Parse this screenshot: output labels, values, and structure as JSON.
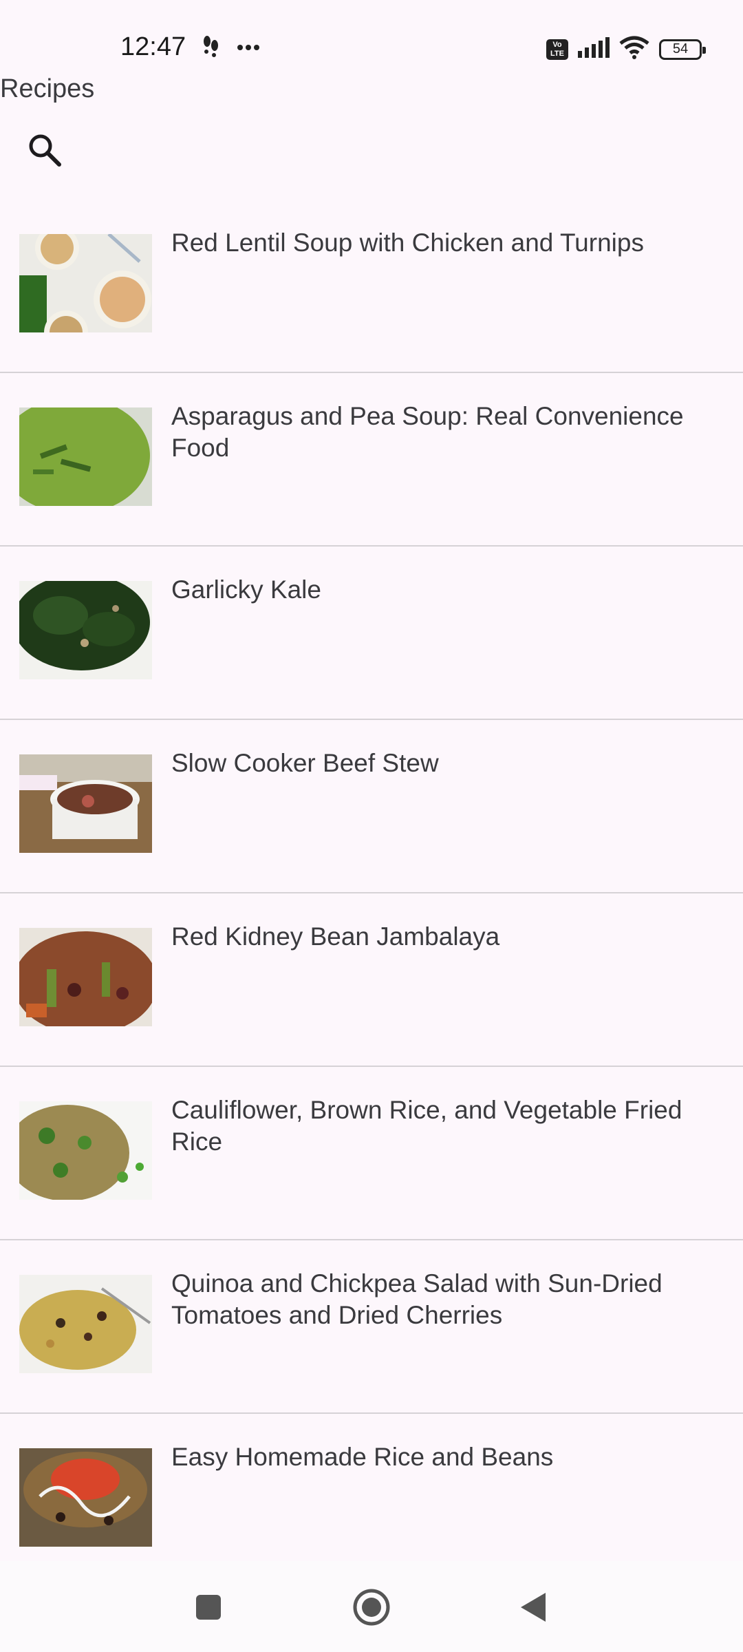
{
  "status_bar": {
    "time": "12:47",
    "battery_level": "54",
    "volte_label": "Vo LTE",
    "icons": [
      "footprints-icon",
      "more-dots-icon",
      "volte-icon",
      "signal-icon",
      "wifi-icon",
      "battery-icon"
    ]
  },
  "app_bar": {
    "title": "Recipes",
    "search_icon": "search-icon"
  },
  "recipes": [
    {
      "title": "Red Lentil Soup with Chicken and Turnips",
      "thumb": "soup-bowls-image"
    },
    {
      "title": "Asparagus and Pea Soup: Real Convenience Food",
      "thumb": "green-soup-image"
    },
    {
      "title": "Garlicky Kale",
      "thumb": "kale-image"
    },
    {
      "title": "Slow Cooker Beef Stew",
      "thumb": "beef-stew-image"
    },
    {
      "title": "Red Kidney Bean Jambalaya",
      "thumb": "jambalaya-image"
    },
    {
      "title": "Cauliflower, Brown Rice, and Vegetable Fried Rice",
      "thumb": "fried-rice-image"
    },
    {
      "title": "Quinoa and Chickpea Salad with Sun-Dried Tomatoes and Dried Cherries",
      "thumb": "quinoa-salad-image"
    },
    {
      "title": "Easy Homemade Rice and Beans",
      "thumb": "rice-beans-image"
    }
  ],
  "nav_bar": {
    "icons": [
      "recents-square-icon",
      "home-circle-icon",
      "back-triangle-icon"
    ]
  }
}
